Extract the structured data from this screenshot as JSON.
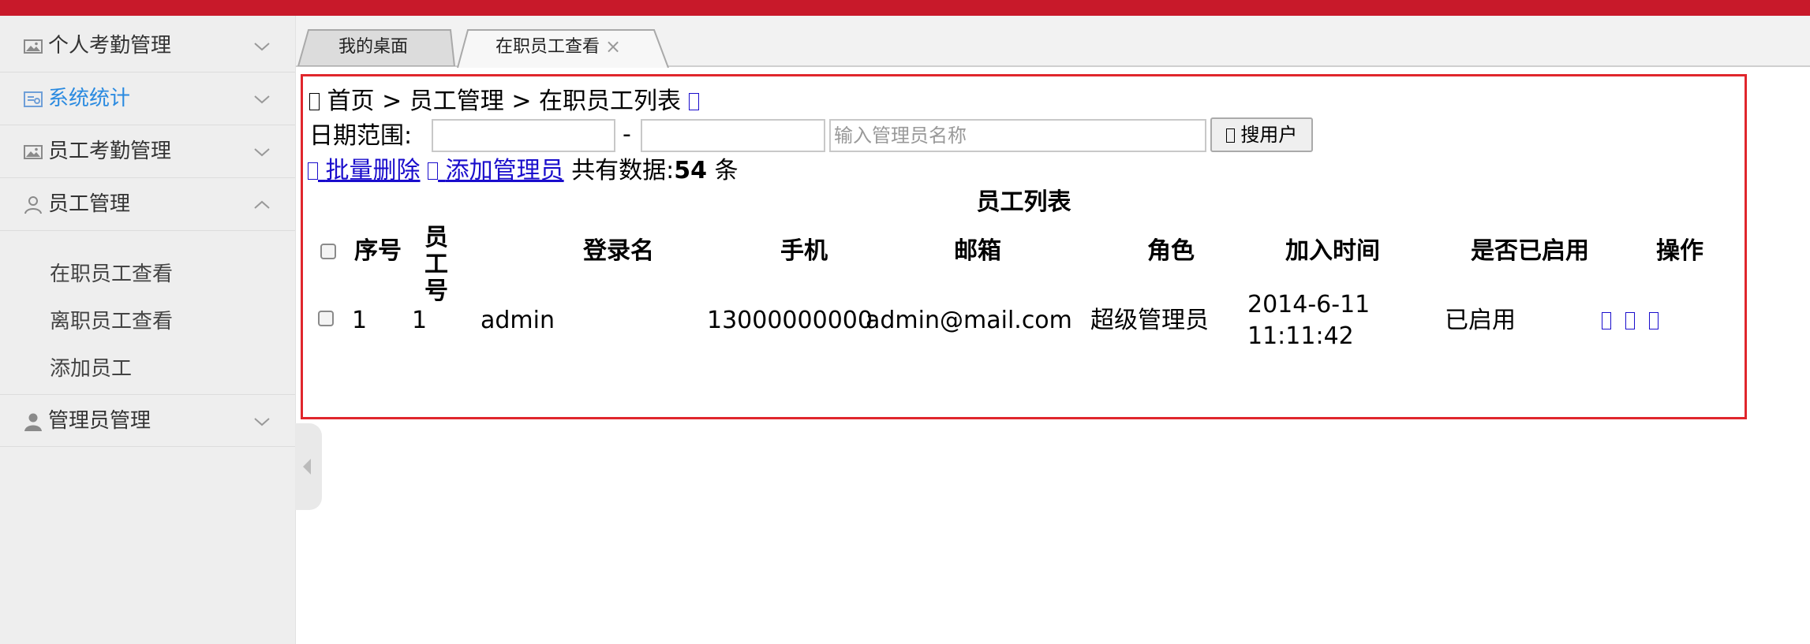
{
  "colors": {
    "top_bar": "#c8192a",
    "active_menu": "#2a8ae0",
    "frame_border": "#e0262c",
    "link": "#1a0dcc"
  },
  "sidebar": {
    "menus": [
      {
        "label": "个人考勤管理",
        "icon": "image-icon",
        "expanded": false,
        "active": false
      },
      {
        "label": "系统统计",
        "icon": "chart-icon",
        "expanded": false,
        "active": true
      },
      {
        "label": "员工考勤管理",
        "icon": "image-icon",
        "expanded": false,
        "active": false
      },
      {
        "label": "员工管理",
        "icon": "user-outline-icon",
        "expanded": true,
        "active": false
      },
      {
        "label": "管理员管理",
        "icon": "user-filled-icon",
        "expanded": false,
        "active": false
      }
    ],
    "submenu": [
      "在职员工查看",
      "离职员工查看",
      "添加员工"
    ]
  },
  "tabs": [
    {
      "label": "我的桌面",
      "active": false
    },
    {
      "label": "在职员工查看",
      "active": true,
      "close": "×"
    }
  ],
  "breadcrumb": {
    "home": "首页",
    "sep1": ">",
    "section": "员工管理",
    "sep2": ">",
    "current": "在职员工列表"
  },
  "filter": {
    "date_label": "日期范围:",
    "dash": "-",
    "start_value": "",
    "end_value": "",
    "name_placeholder": "输入管理员名称",
    "search_label": "搜用户"
  },
  "toolbar": {
    "batch_delete": "批量删除",
    "add_admin": "添加管理员",
    "total_prefix": "共有数据:",
    "total_count": "54",
    "total_suffix": "条"
  },
  "table": {
    "caption": "员工列表",
    "columns": [
      "序号",
      "员工号",
      "登录名",
      "手机",
      "邮箱",
      "角色",
      "加入时间",
      "是否已启用",
      "操作"
    ],
    "rows": [
      {
        "seq": "1",
        "emp_no": "1",
        "login": "admin",
        "phone": "13000000000",
        "email": "admin@mail.com",
        "role": "超级管理员",
        "joined_date": "2014-6-11",
        "joined_time": "11:11:42",
        "status": "已启用"
      }
    ]
  }
}
